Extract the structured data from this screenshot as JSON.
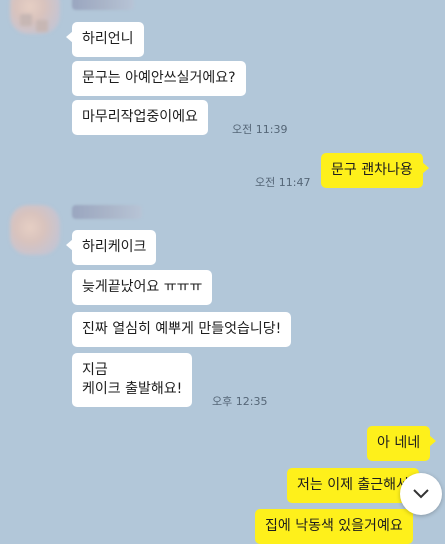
{
  "conversation": [
    {
      "id": "a",
      "messages": [
        "하리언니",
        "문구는 아예안쓰실거에요?",
        "마무리작업중이에요"
      ],
      "time": "오전 11:39"
    },
    {
      "id": "b",
      "messages": [
        "문구 괜차나용"
      ],
      "time": "오전 11:47"
    },
    {
      "id": "c",
      "messages": [
        "하리케이크",
        "늦게끝났어요 ㅠㅠㅠ",
        "진짜 열심히 예뿌게 만들엇습니당!",
        "지금\n케이크 출발해요!"
      ],
      "time": "오후 12:35"
    },
    {
      "id": "d",
      "messages": [
        "아 네네",
        "저는 이제 출근해서",
        "집에 낙동색 있을거예요"
      ]
    }
  ],
  "icons": {
    "scroll_down": "chevron-down-icon"
  },
  "colors": {
    "background": "#b2c7d9",
    "my_bubble": "#fef01b",
    "other_bubble": "#ffffff"
  }
}
